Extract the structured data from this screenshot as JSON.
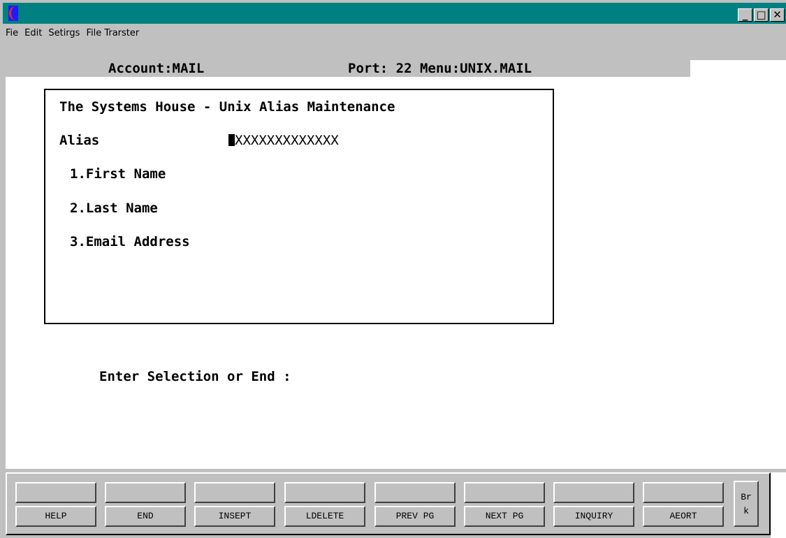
{
  "window": {
    "controls": [
      "_",
      "□",
      "✕"
    ],
    "app_icon": "crescent-app-icon"
  },
  "menu": [
    "Fie",
    "Edit",
    "Setirgs",
    "File Trarster"
  ],
  "status": {
    "account": "Account:MAIL",
    "port_menu": "Port: 22 Menu:UNIX.MAIL"
  },
  "screen": {
    "title": "The Systems House - Unix Alias Maintenance",
    "alias_label": "Alias",
    "alias_value": "XXXXXXXXXXXXX",
    "fields": [
      "1.First Name",
      "2.Last Name",
      "3.Email Address"
    ],
    "prompt": "Enter Selection or End :"
  },
  "function_keys": [
    "HELP",
    "END",
    "INSEPT",
    "LDELETE",
    "PREV PG",
    "NEXT PG",
    "INQUIRY",
    "AEORT"
  ],
  "break_key": [
    "Br",
    "k"
  ]
}
